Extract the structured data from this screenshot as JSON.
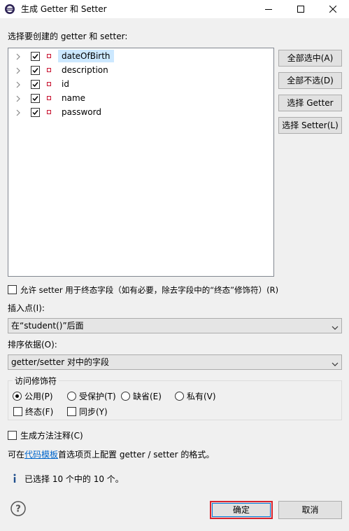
{
  "window": {
    "title": "生成 Getter 和 Setter",
    "controls": [
      "minimize-icon",
      "maximize-icon",
      "close-icon"
    ]
  },
  "tree_label": "选择要创建的 getter 和 setter:",
  "fields": [
    {
      "name": "dateOfBirth",
      "checked": true,
      "selected": true
    },
    {
      "name": "description",
      "checked": true,
      "selected": false
    },
    {
      "name": "id",
      "checked": true,
      "selected": false
    },
    {
      "name": "name",
      "checked": true,
      "selected": false
    },
    {
      "name": "password",
      "checked": true,
      "selected": false
    }
  ],
  "side_buttons": {
    "select_all": "全部选中(A)",
    "deselect_all": "全部不选(D)",
    "select_getters": "选择 Getter",
    "select_setters": "选择 Setter(L)"
  },
  "allow_final_setter": {
    "label": "允许 setter 用于终态字段（如有必要，除去字段中的“终态”修饰符）(R)",
    "checked": false
  },
  "insertion": {
    "label": "插入点(I):",
    "value": "在“student()”后面"
  },
  "sort": {
    "label": "排序依据(O):",
    "value": "getter/setter 对中的字段"
  },
  "access": {
    "title": "访问修饰符",
    "options": [
      {
        "label": "公用(P)",
        "selected": true
      },
      {
        "label": "受保护(T)",
        "selected": false
      },
      {
        "label": "缺省(E)",
        "selected": false
      },
      {
        "label": "私有(V)",
        "selected": false
      }
    ],
    "final": {
      "label": "终态(F)",
      "checked": false
    },
    "synchronized": {
      "label": "同步(Y)",
      "checked": false
    }
  },
  "generate_comments": {
    "label": "生成方法注释(C)",
    "checked": false
  },
  "template_note": {
    "prefix": "可在",
    "link": "代码模板",
    "suffix": "首选项页上配置 getter / setter 的格式。"
  },
  "status": "已选择 10 个中的 10 个。",
  "footer": {
    "ok": "确定",
    "cancel": "取消"
  },
  "colors": {
    "selection": "#cce8ff",
    "field_icon": "#c8102e",
    "link": "#0066cc",
    "ok_border": "#d9232d"
  }
}
